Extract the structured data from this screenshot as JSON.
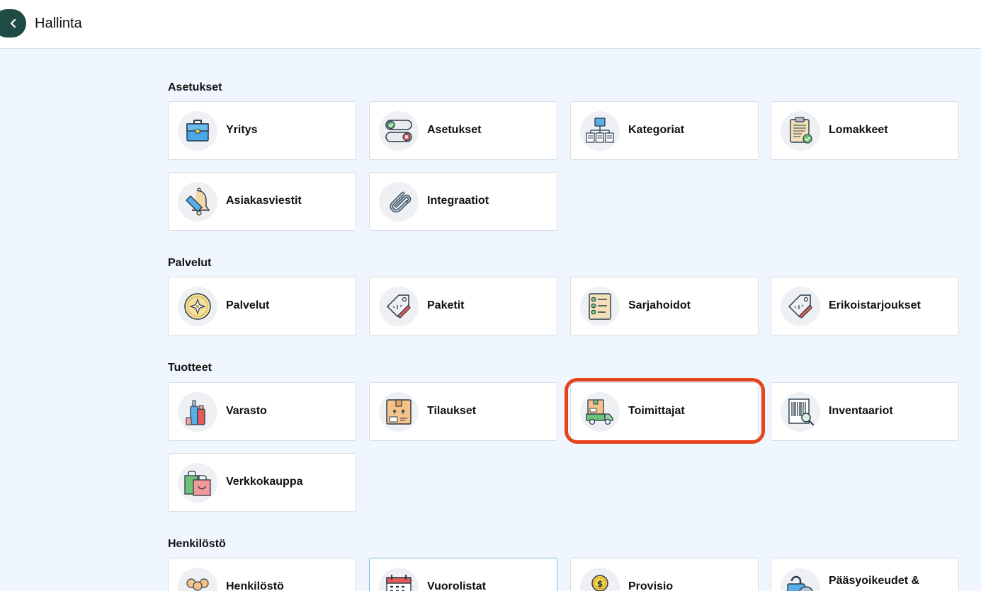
{
  "header": {
    "title": "Hallinta",
    "back_icon": "chevron-left-icon"
  },
  "colors": {
    "brand": "#1f4b45",
    "highlight": "#e8431f",
    "background": "#f0f6fd"
  },
  "sections": [
    {
      "title": "Asetukset",
      "items": [
        {
          "label": "Yritys",
          "icon": "briefcase-icon"
        },
        {
          "label": "Asetukset",
          "icon": "toggle-switches-icon"
        },
        {
          "label": "Kategoriat",
          "icon": "hierarchy-icon"
        },
        {
          "label": "Lomakkeet",
          "icon": "clipboard-check-icon"
        },
        {
          "label": "Asiakasviestit",
          "icon": "bell-icon"
        },
        {
          "label": "Integraatiot",
          "icon": "paperclip-icon"
        }
      ]
    },
    {
      "title": "Palvelut",
      "items": [
        {
          "label": "Palvelut",
          "icon": "spa-flower-icon"
        },
        {
          "label": "Paketit",
          "icon": "price-tag-icon"
        },
        {
          "label": "Sarjahoidot",
          "icon": "checklist-icon"
        },
        {
          "label": "Erikoistarjoukset",
          "icon": "discount-tag-icon"
        }
      ]
    },
    {
      "title": "Tuotteet",
      "items": [
        {
          "label": "Varasto",
          "icon": "cosmetics-bottles-icon"
        },
        {
          "label": "Tilaukset",
          "icon": "package-box-icon"
        },
        {
          "label": "Toimittajat",
          "icon": "delivery-truck-icon"
        },
        {
          "label": "Inventaariot",
          "icon": "barcode-search-icon"
        },
        {
          "label": "Verkkokauppa",
          "icon": "shopping-bag-icon"
        }
      ]
    },
    {
      "title": "Henkilöstö",
      "items": [
        {
          "label": "Henkilöstö",
          "icon": "staff-group-icon"
        },
        {
          "label": "Vuorolistat",
          "icon": "calendar-icon"
        },
        {
          "label": "Provisio",
          "icon": "coin-hand-icon"
        },
        {
          "label": "Pääsyoikeudet &",
          "icon": "lock-key-icon"
        }
      ]
    }
  ]
}
